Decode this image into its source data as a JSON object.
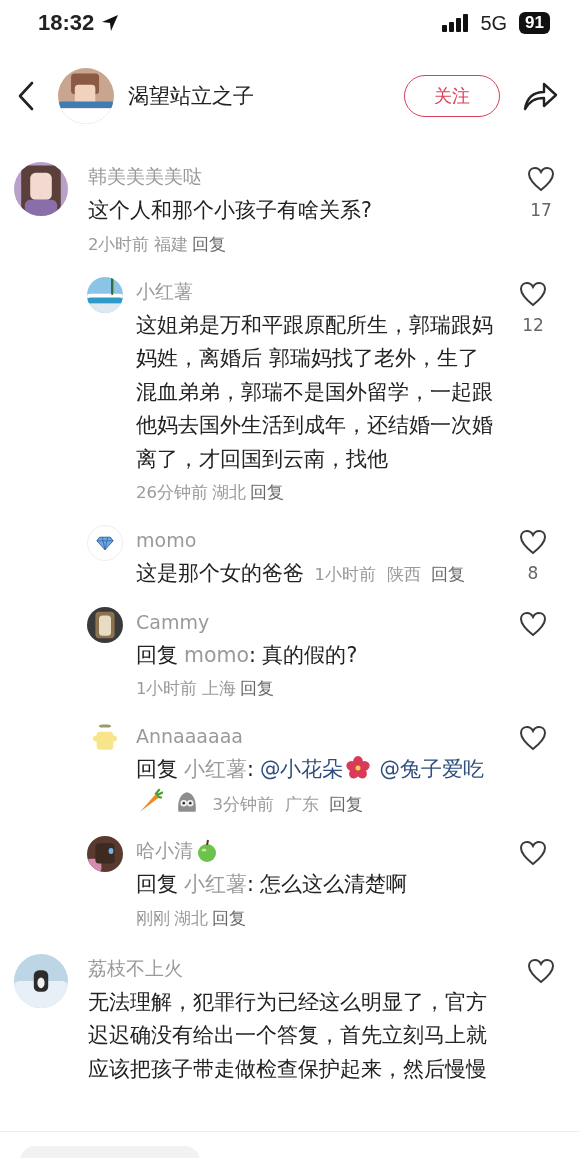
{
  "status_bar": {
    "time": "18:32",
    "network": "5G",
    "battery": "91"
  },
  "header": {
    "avatar": {
      "kind": "picture"
    },
    "title": "渴望站立之子",
    "follow_button": "关注"
  },
  "comments": [
    {
      "user": "韩美美美美哒",
      "avatar": {
        "kind": "picture"
      },
      "content": [
        {
          "kind": "text",
          "text": "这个人和那个小孩子有啥关系?"
        }
      ],
      "meta_inline": false,
      "time": "2小时前",
      "location": "福建",
      "reply": "回复",
      "liked": false,
      "likes": "17",
      "children": [
        {
          "user": "小红薯",
          "avatar": {
            "kind": "picture"
          },
          "content": [
            {
              "kind": "text",
              "text": "这姐弟是万和平跟原配所生，郭瑞跟妈妈姓，离婚后 郭瑞妈找了老外，生了混血弟弟，郭瑞不是国外留学，一起跟他妈去国外生活到成年，还结婚一次婚离了，才回国到云南，找他"
            }
          ],
          "meta_inline": false,
          "time": "26分钟前",
          "location": "湖北",
          "reply": "回复",
          "liked": false,
          "likes": "12"
        },
        {
          "user": "momo",
          "avatar": {
            "kind": "icon"
          },
          "content": [
            {
              "kind": "text",
              "text": "这是那个女的爸爸"
            }
          ],
          "meta_inline": true,
          "time": "1小时前",
          "location": "陕西",
          "reply": "回复",
          "liked": false,
          "likes": "8"
        },
        {
          "user": "Cammy",
          "avatar": {
            "kind": "picture"
          },
          "content": [
            {
              "kind": "reply_label",
              "text": "回复"
            },
            {
              "kind": "target",
              "text": "momo"
            },
            {
              "kind": "text",
              "text": ": 真的假的?"
            }
          ],
          "meta_inline": false,
          "time": "1小时前",
          "location": "上海",
          "reply": "回复",
          "liked": false
        },
        {
          "user": "Annaaaaaa",
          "avatar": {
            "kind": "picture"
          },
          "content": [
            {
              "kind": "reply_label",
              "text": "回复"
            },
            {
              "kind": "target",
              "text": "小红薯"
            },
            {
              "kind": "text",
              "text": ":"
            },
            {
              "kind": "mention",
              "text": "@小花朵"
            },
            {
              "kind": "flower"
            },
            {
              "kind": "mention",
              "text": "@兔子爱吃"
            },
            {
              "kind": "carrot"
            },
            {
              "kind": "sticker"
            }
          ],
          "meta_inline": true,
          "time": "3分钟前",
          "location": "广东",
          "reply": "回复",
          "liked": false
        },
        {
          "user": "哈小清",
          "badge": {
            "kind": "apple"
          },
          "avatar": {
            "kind": "picture"
          },
          "content": [
            {
              "kind": "reply_label",
              "text": "回复"
            },
            {
              "kind": "target",
              "text": "小红薯"
            },
            {
              "kind": "text",
              "text": ": 怎么这么清楚啊"
            }
          ],
          "meta_inline": false,
          "time": "刚刚",
          "location": "湖北",
          "reply": "回复",
          "liked": false
        }
      ]
    },
    {
      "user": "荔枝不上火",
      "avatar": {
        "kind": "picture"
      },
      "content": [
        {
          "kind": "text",
          "text": "无法理解，犯罪行为已经这么明显了，官方迟迟确没有给出一个答复，首先立刻马上就应该把孩子带走做检查保护起来，然后慢慢"
        }
      ],
      "liked": false
    }
  ]
}
